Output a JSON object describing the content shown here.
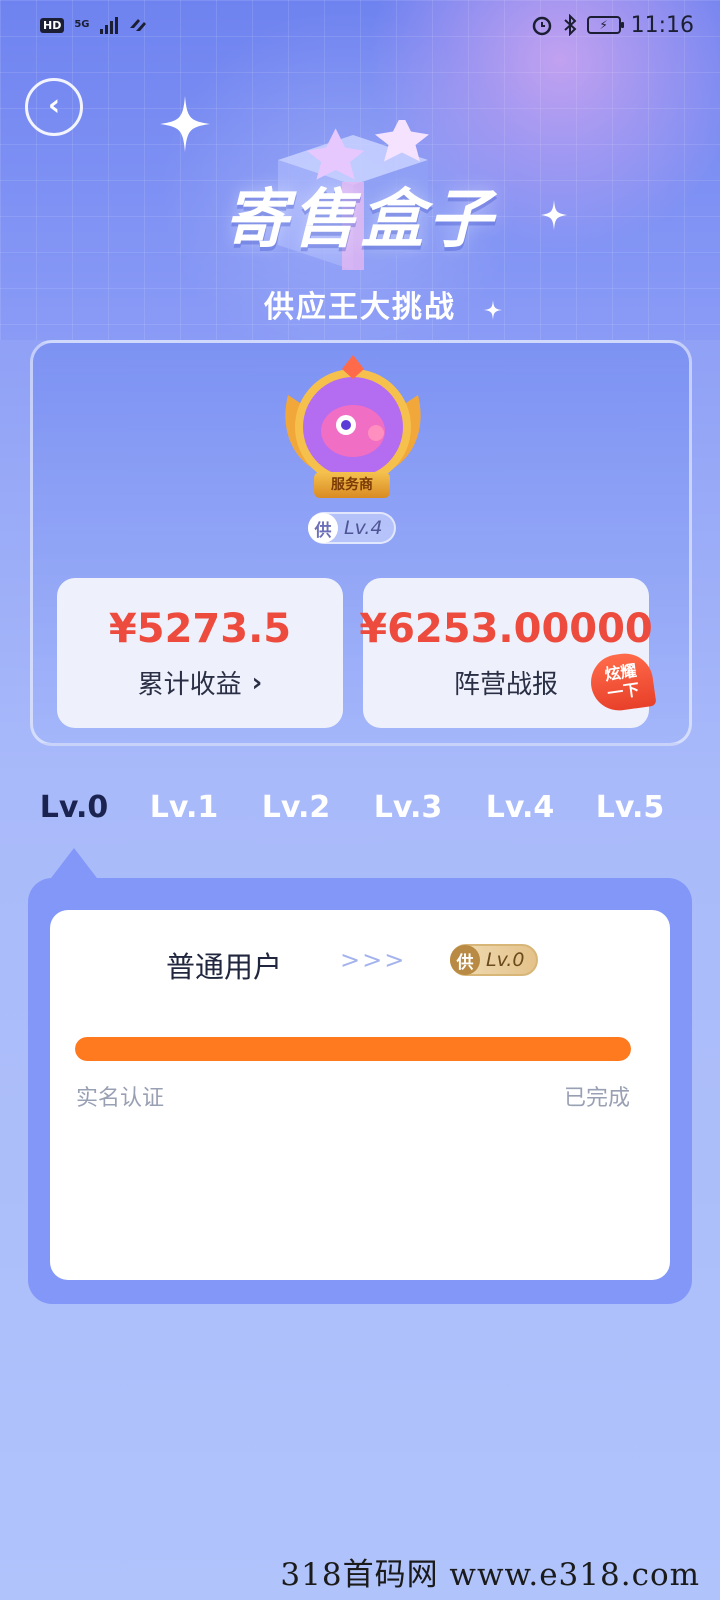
{
  "status_bar": {
    "hd": "HD",
    "network": "5G",
    "time": "11:16"
  },
  "header": {
    "title": "寄售盒子",
    "subtitle": "供应王大挑战"
  },
  "profile": {
    "medal_label": "服务商",
    "supplier_badge_char": "供",
    "level": "Lv.4"
  },
  "stats": {
    "cumulative_income_value": "¥5273.5",
    "cumulative_income_label": "累计收益",
    "camp_report_value": "¥6253.00000",
    "camp_report_label": "阵营战报",
    "show_off_badge_line1": "炫耀",
    "show_off_badge_line2": "一下"
  },
  "tabs": [
    "Lv.0",
    "Lv.1",
    "Lv.2",
    "Lv.3",
    "Lv.4",
    "Lv.5"
  ],
  "active_tab": "Lv.0",
  "level_panel": {
    "from_label": "普通用户",
    "arrows": ">>>",
    "target_badge_char": "供",
    "target_level": "Lv.0",
    "requirement_label": "实名认证",
    "requirement_status": "已完成",
    "progress_fraction": 1.0
  },
  "watermark": "318首码网  www.e318.com",
  "colors": {
    "accent_red": "#ec4b3d",
    "progress_orange": "#ff7a1f",
    "tab_active": "#1b2350"
  }
}
